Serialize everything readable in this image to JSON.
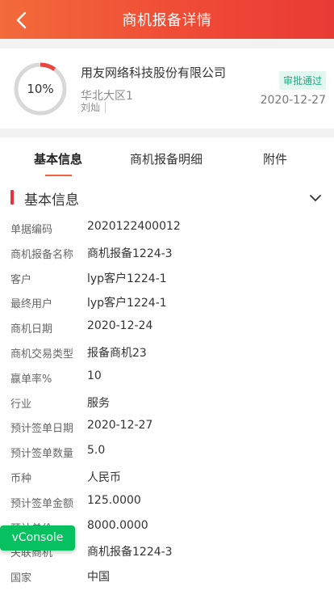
{
  "header": {
    "title": "商机报备详情",
    "back_icon": "chevron-left-icon"
  },
  "summary": {
    "progress_text": "10%",
    "progress_value": 0.1,
    "company": "用友网络科技股份有限公司",
    "region": "华北大区1",
    "owner": "刘灿",
    "status": "审批通过",
    "date": "2020-12-27",
    "colors": {
      "progress": "#e8453c",
      "status_text": "#1faa80",
      "status_bg": "#e3f6f0"
    }
  },
  "tabs": [
    {
      "label": "基本信息",
      "active": true
    },
    {
      "label": "商机报备明细",
      "active": false
    },
    {
      "label": "附件",
      "active": false
    }
  ],
  "section": {
    "title": "基本信息",
    "toggle_icon": "chevron-down-icon"
  },
  "fields": [
    {
      "label": "单据编码",
      "value": "2020122400012"
    },
    {
      "label": "商机报备名称",
      "value": "商机报备1224-3"
    },
    {
      "label": "客户",
      "value": "lyp客户1224-1"
    },
    {
      "label": "最终用户",
      "value": "lyp客户1224-1"
    },
    {
      "label": "商机日期",
      "value": "2020-12-24"
    },
    {
      "label": "商机交易类型",
      "value": "报备商机23"
    },
    {
      "label": "赢单率%",
      "value": "10"
    },
    {
      "label": "行业",
      "value": "服务"
    },
    {
      "label": "预计签单日期",
      "value": "2020-12-27"
    },
    {
      "label": "预计签单数量",
      "value": "5.0"
    },
    {
      "label": "币种",
      "value": "人民币"
    },
    {
      "label": "预计签单金额",
      "value": "125.0000"
    },
    {
      "label": "预计单价",
      "value": "8000.0000"
    },
    {
      "label": "关联商机",
      "value": "商机报备1224-3"
    },
    {
      "label": "国家",
      "value": "中国"
    }
  ],
  "vconsole": {
    "label": "vConsole"
  },
  "theme": {
    "accent": "#ef4b36",
    "tab_underline": "#f0623d"
  }
}
